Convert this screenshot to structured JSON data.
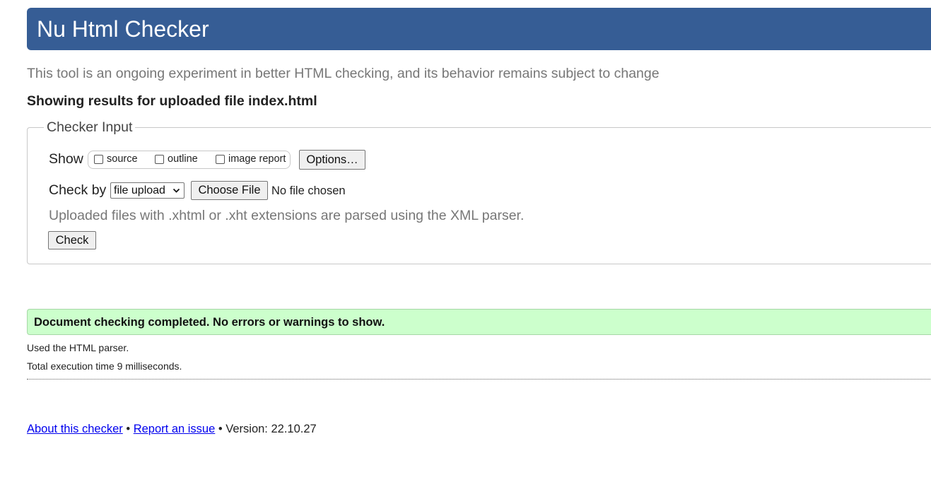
{
  "header": {
    "title": "Nu Html Checker"
  },
  "tagline": "This tool is an ongoing experiment in better HTML checking, and its behavior remains subject to change",
  "showing": "Showing results for uploaded file index.html",
  "checker_input": {
    "legend": "Checker Input",
    "show_label": "Show",
    "show_options": [
      {
        "label": "source",
        "checked": false
      },
      {
        "label": "outline",
        "checked": false
      },
      {
        "label": "image report",
        "checked": false
      }
    ],
    "options_button": "Options…",
    "check_by_label": "Check by",
    "check_by_selected": "file upload",
    "choose_file_button": "Choose File",
    "file_status": "No file chosen",
    "note": "Uploaded files with .xhtml or .xht extensions are parsed using the XML parser.",
    "check_button": "Check"
  },
  "results": {
    "success_message": "Document checking completed. No errors or warnings to show.",
    "parser_note": "Used the HTML parser.",
    "execution_time": "Total execution time 9 milliseconds."
  },
  "footer": {
    "about_link": "About this checker",
    "separator": "•",
    "report_link": "Report an issue",
    "version": "Version: 22.10.27"
  },
  "colors": {
    "header_bg": "#365d95",
    "success_bg": "#ccffcc",
    "link": "#0000ee"
  }
}
